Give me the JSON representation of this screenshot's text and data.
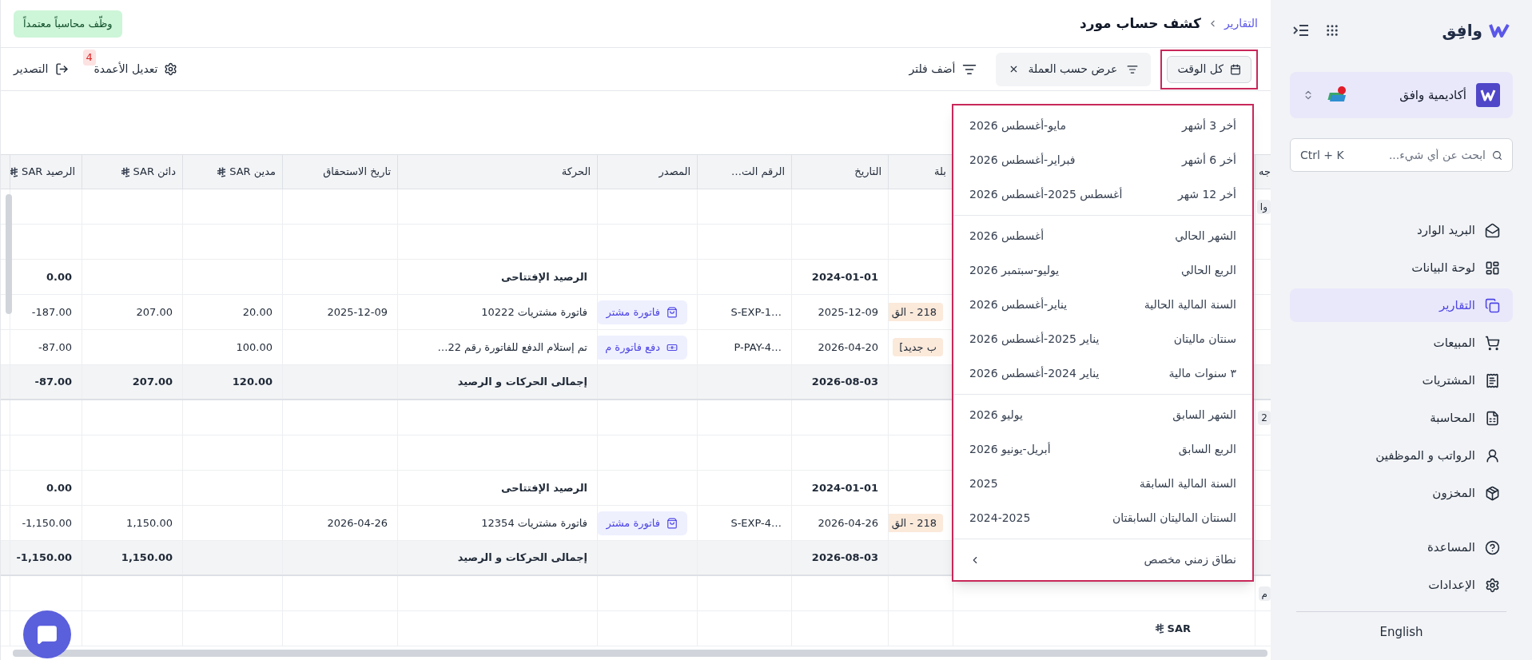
{
  "sidebar": {
    "logo": "وافِق",
    "organization": "أكاديمية وافق",
    "search": {
      "placeholder": "ابحث عن أي شيء...",
      "shortcut": "Ctrl + K"
    },
    "items": [
      {
        "label": "البريد الوارد",
        "selected": false
      },
      {
        "label": "لوحة البيانات",
        "selected": false
      },
      {
        "label": "التقارير",
        "selected": true
      },
      {
        "label": "المبيعات",
        "selected": false
      },
      {
        "label": "المشتريات",
        "selected": false
      },
      {
        "label": "المحاسبة",
        "selected": false
      },
      {
        "label": "الرواتب و الموظفين",
        "selected": false
      },
      {
        "label": "المخزون",
        "selected": false
      }
    ],
    "footer_items": [
      {
        "label": "المساعدة"
      },
      {
        "label": "الإعدادات"
      }
    ],
    "language": "English"
  },
  "header": {
    "breadcrumb": "التقارير",
    "title": "كشف حساب مورد",
    "promo": "وظّف محاسباً معتمداً"
  },
  "toolbar": {
    "date_filter": "كل الوقت",
    "active_filter": "عرض حسب العملة",
    "add_filter": "أضف فلتر",
    "columns": "تعديل الأعمدة",
    "columns_badge": "4",
    "export": "التصدير"
  },
  "table": {
    "columns": [
      {
        "label": "جه"
      },
      {
        "label": "بلة"
      },
      {
        "label": "التاريخ"
      },
      {
        "label": "الرقم الت…"
      },
      {
        "label": "المصدر"
      },
      {
        "label": "الحركة"
      },
      {
        "label": "تاريخ الاستحقاق"
      },
      {
        "label": "مدين SAR",
        "currency": true
      },
      {
        "label": "دائن SAR",
        "currency": true
      },
      {
        "label": "الرصيد SAR",
        "currency": true
      }
    ],
    "rows": [
      {
        "kind": "group",
        "column_1": "وا"
      },
      {
        "kind": "blank"
      },
      {
        "kind": "opening",
        "date": "2024-01-01",
        "movement": "الرصيد الإفتتاحى",
        "balance": "0.00"
      },
      {
        "kind": "entry",
        "column_3": "218 - الق",
        "date": "2025-12-09",
        "reference": "S-EXP-1…",
        "source": {
          "label": "فاتورة مشتر",
          "kind": "invoice"
        },
        "movement": "فاتورة مشتريات 10222",
        "due_date": "2025-12-09",
        "debit": "20.00",
        "credit": "207.00",
        "balance": "-187.00"
      },
      {
        "kind": "entry",
        "column_3": "ب جديد]",
        "date": "2026-04-20",
        "reference": "P-PAY-4…",
        "source": {
          "label": "دفع فاتورة م",
          "kind": "payment"
        },
        "movement": "تم إستلام الدفع للفاتورة رقم 22…",
        "debit": "100.00",
        "balance": "-87.00"
      },
      {
        "kind": "total",
        "date": "2026-08-03",
        "movement": "إجمالى الحركات و الرصيد",
        "debit": "120.00",
        "credit": "207.00",
        "balance": "-87.00"
      },
      {
        "kind": "group",
        "column_1": "2"
      },
      {
        "kind": "blank"
      },
      {
        "kind": "opening",
        "date": "2024-01-01",
        "movement": "الرصيد الإفتتاحى",
        "balance": "0.00"
      },
      {
        "kind": "entry",
        "column_3": "218 - الق",
        "date": "2026-04-26",
        "reference": "S-EXP-4…",
        "source": {
          "label": "فاتورة مشتر",
          "kind": "invoice"
        },
        "movement": "فاتورة مشتريات 12354",
        "due_date": "2026-04-26",
        "credit": "1,150.00",
        "balance": "-1,150.00"
      },
      {
        "kind": "total",
        "date": "2026-08-03",
        "movement": "إجمالى الحركات و الرصيد",
        "credit": "1,150.00",
        "balance": "-1,150.00"
      },
      {
        "kind": "group",
        "column_1": "م"
      },
      {
        "kind": "currency",
        "column_2": "SAR"
      }
    ]
  },
  "date_menu": {
    "groups": [
      [
        {
          "label": "أخر 3 أشهر",
          "range": "مايو-أغسطس 2026"
        },
        {
          "label": "أخر 6 أشهر",
          "range": "فبراير-أغسطس 2026"
        },
        {
          "label": "أخر 12 شهر",
          "range": "أغسطس 2025-أغسطس 2026"
        }
      ],
      [
        {
          "label": "الشهر الحالي",
          "range": "أغسطس 2026"
        },
        {
          "label": "الربع الحالي",
          "range": "يوليو-سبتمبر 2026"
        },
        {
          "label": "السنة المالية الحالية",
          "range": "يناير-أغسطس 2026"
        },
        {
          "label": "سنتان ماليتان",
          "range": "يناير 2025-أغسطس 2026"
        },
        {
          "label": "٣ سنوات مالية",
          "range": "يناير 2024-أغسطس 2026"
        }
      ],
      [
        {
          "label": "الشهر السابق",
          "range": "يوليو 2026"
        },
        {
          "label": "الربع السابق",
          "range": "أبريل-يونيو 2026"
        },
        {
          "label": "السنة المالية السابقة",
          "range": "2025"
        },
        {
          "label": "السنتان الماليتان السابقتان",
          "range": "2024-2025"
        }
      ]
    ],
    "custom_range": "نطاق زمني مخصص"
  }
}
